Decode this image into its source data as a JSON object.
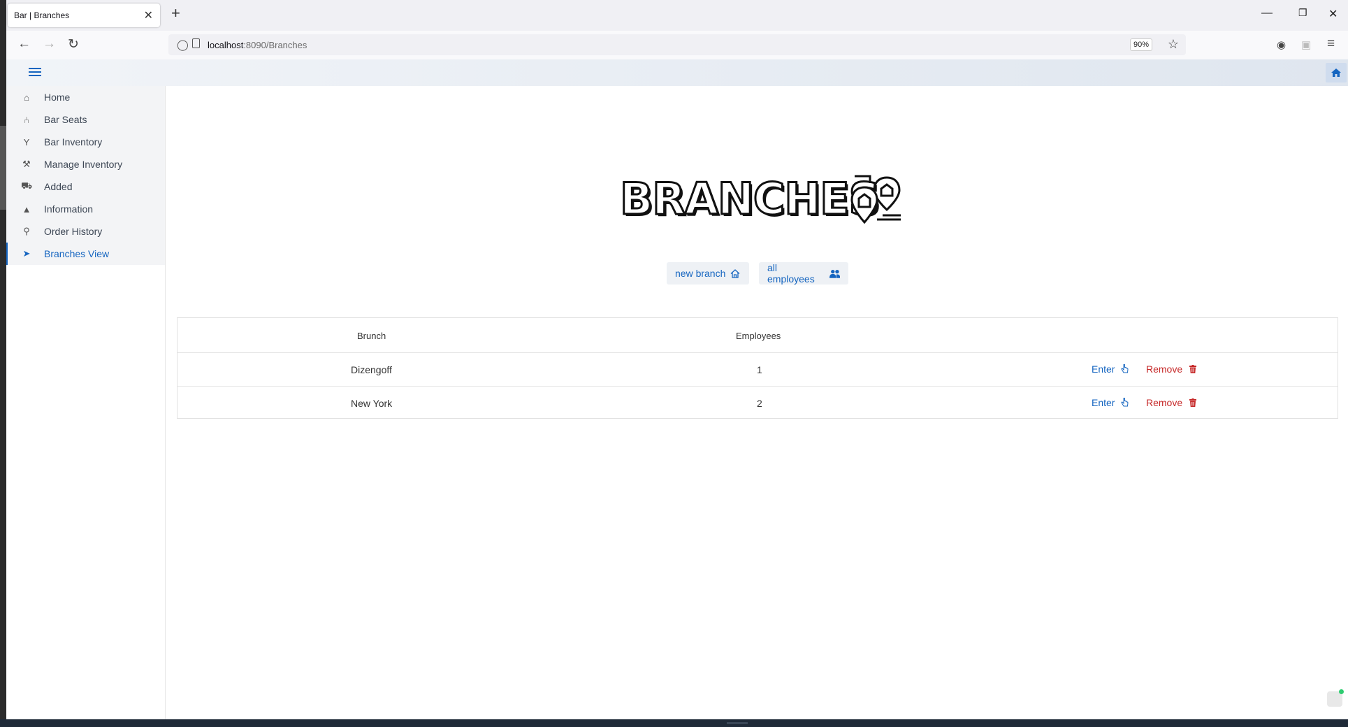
{
  "browser": {
    "tab_title": "Bar | Branches",
    "tab_close": "✕",
    "new_tab": "+",
    "url_host": "localhost",
    "url_path": ":8090/Branches",
    "zoom": "90%"
  },
  "sidebar": {
    "items": [
      {
        "label": "Home",
        "icon": "home-icon",
        "glyph": "⌂"
      },
      {
        "label": "Bar Seats",
        "icon": "chair-icon",
        "glyph": "⑃"
      },
      {
        "label": "Bar Inventory",
        "icon": "cocktail-icon",
        "glyph": "Y"
      },
      {
        "label": "Manage Inventory",
        "icon": "wrench-icon",
        "glyph": "⚒"
      },
      {
        "label": "Added",
        "icon": "cart-icon",
        "glyph": "⛟"
      },
      {
        "label": "Information",
        "icon": "chart-icon",
        "glyph": "▲"
      },
      {
        "label": "Order History",
        "icon": "search-icon",
        "glyph": "⚲"
      },
      {
        "label": "Branches View",
        "icon": "location-arrow-icon",
        "glyph": "➤"
      }
    ],
    "active": "Branches View"
  },
  "main": {
    "logo_text": "BRANCHES",
    "new_branch_label": "new branch",
    "all_employees_label": "all employees",
    "table": {
      "headers": [
        "Brunch",
        "Employees"
      ],
      "rows": [
        {
          "branch": "Dizengoff",
          "employees": "1",
          "enter": "Enter",
          "remove": "Remove"
        },
        {
          "branch": "New York",
          "employees": "2",
          "enter": "Enter",
          "remove": "Remove"
        }
      ]
    }
  },
  "colors": {
    "accent": "#1565c0",
    "danger": "#c62828"
  }
}
